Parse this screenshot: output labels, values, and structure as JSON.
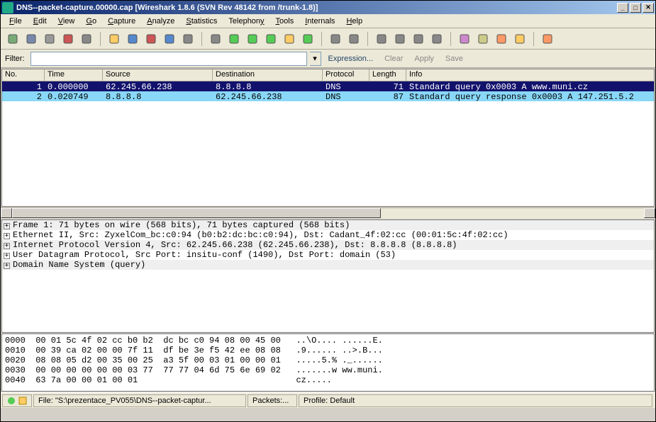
{
  "title": "DNS--packet-capture.00000.cap   [Wireshark 1.8.6  (SVN Rev 48142 from /trunk-1.8)]",
  "menu": {
    "file": "File",
    "edit": "Edit",
    "view": "View",
    "go": "Go",
    "capture": "Capture",
    "analyze": "Analyze",
    "statistics": "Statistics",
    "telephony": "Telephony",
    "tools": "Tools",
    "internals": "Internals",
    "help": "Help"
  },
  "toolbar_icons": [
    "interfaces-icon",
    "capture-options-icon",
    "start-capture-icon",
    "stop-capture-icon",
    "restart-capture-icon",
    "sep",
    "open-icon",
    "save-icon",
    "close-icon",
    "reload-icon",
    "print-icon",
    "sep",
    "find-icon",
    "go-back-icon",
    "go-forward-icon",
    "go-to-icon",
    "go-first-icon",
    "go-last-icon",
    "sep",
    "colorize-icon",
    "auto-scroll-icon",
    "sep",
    "zoom-in-icon",
    "zoom-out-icon",
    "zoom-fit-icon",
    "resize-columns-icon",
    "sep",
    "capture-filter-icon",
    "display-filter-icon",
    "coloring-rules-icon",
    "prefs-icon",
    "sep",
    "help-toolbar-icon"
  ],
  "filter": {
    "label": "Filter:",
    "value": "",
    "expression": "Expression...",
    "clear": "Clear",
    "apply": "Apply",
    "save": "Save"
  },
  "columns": {
    "no": "No.",
    "time": "Time",
    "source": "Source",
    "destination": "Destination",
    "protocol": "Protocol",
    "length": "Length",
    "info": "Info"
  },
  "packets": [
    {
      "no": "1",
      "time": "0.000000",
      "src": "62.245.66.238",
      "dst": "8.8.8.8",
      "proto": "DNS",
      "len": "71",
      "info": "Standard query 0x0003  A www.muni.cz",
      "selected": true
    },
    {
      "no": "2",
      "time": "0.020749",
      "src": "8.8.8.8",
      "dst": "62.245.66.238",
      "proto": "DNS",
      "len": "87",
      "info": "Standard query response 0x0003  A 147.251.5.2",
      "highlight": true
    }
  ],
  "details": [
    "Frame 1: 71 bytes on wire (568 bits), 71 bytes captured (568 bits)",
    "Ethernet II, Src: ZyxelCom_bc:c0:94 (b0:b2:dc:bc:c0:94), Dst: Cadant_4f:02:cc (00:01:5c:4f:02:cc)",
    "Internet Protocol Version 4, Src: 62.245.66.238 (62.245.66.238), Dst: 8.8.8.8 (8.8.8.8)",
    "User Datagram Protocol, Src Port: insitu-conf (1490), Dst Port: domain (53)",
    "Domain Name System (query)"
  ],
  "hex": [
    "0000  00 01 5c 4f 02 cc b0 b2  dc bc c0 94 08 00 45 00   ..\\O.... ......E.",
    "0010  00 39 ca 02 00 00 7f 11  df be 3e f5 42 ee 08 08   .9...... ..>.B...",
    "0020  08 08 05 d2 00 35 00 25  a3 5f 00 03 01 00 00 01   .....5.% ._......",
    "0030  00 00 00 00 00 00 03 77  77 77 04 6d 75 6e 69 02   .......w ww.muni.",
    "0040  63 7a 00 00 01 00 01                               cz..... "
  ],
  "status": {
    "file": "File: \"S:\\prezentace_PV055\\DNS--packet-captur...",
    "packets": "Packets:...",
    "profile": "Profile: Default"
  }
}
